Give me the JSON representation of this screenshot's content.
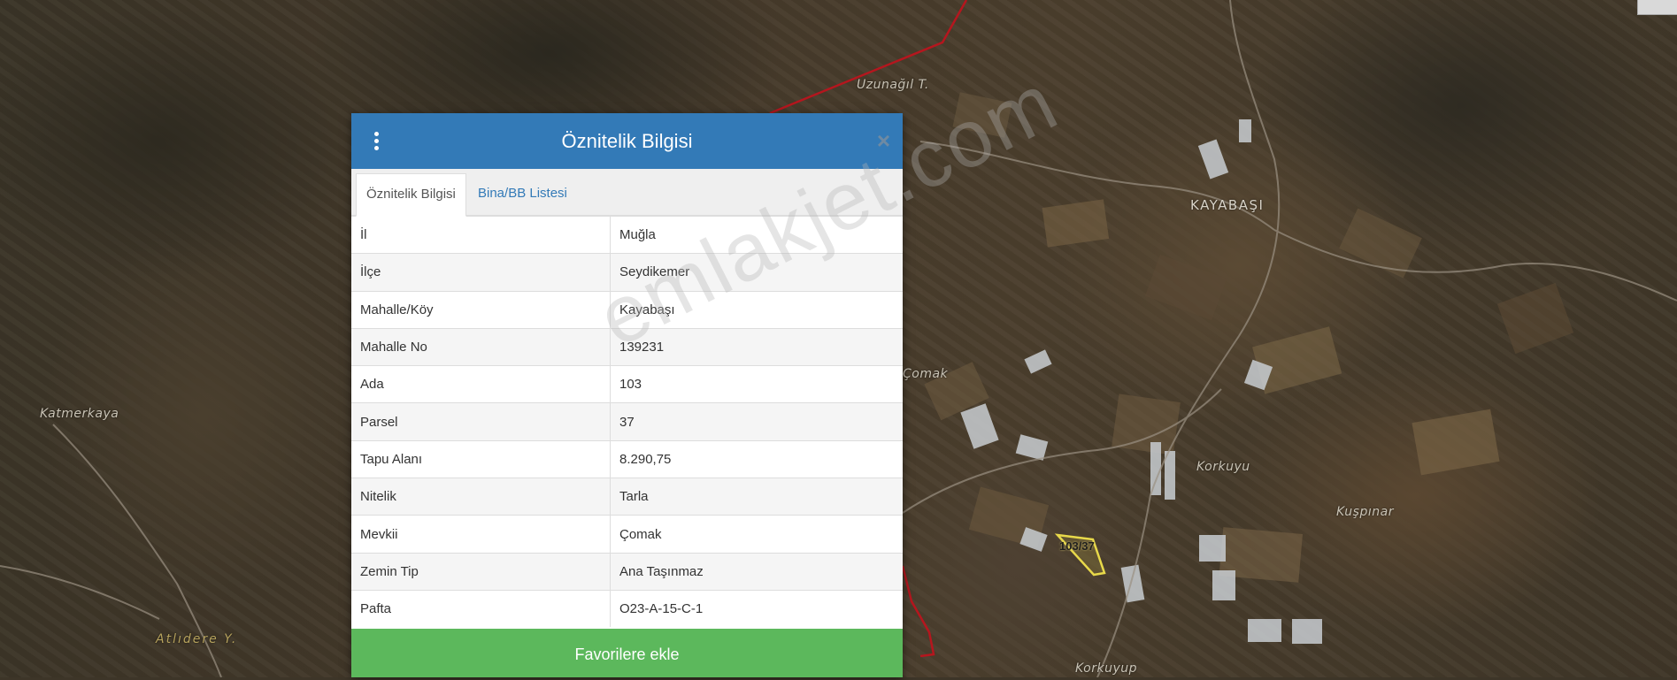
{
  "map": {
    "labels": [
      "Uzunağıl T.",
      "KAYABAŞI",
      "Çomak",
      "Katmerkaya",
      "Korkuyu",
      "Kuşpınar",
      "Atlıdere Y.",
      "Korkuyup"
    ],
    "parcel_label": "103/37",
    "watermark": "emlakjet.com"
  },
  "modal": {
    "title": "Öznitelik Bilgisi",
    "menu_icon": "kebab-menu-icon",
    "close_symbol": "×",
    "tabs": [
      {
        "label": "Öznitelik Bilgisi",
        "active": true
      },
      {
        "label": "Bina/BB Listesi",
        "active": false
      }
    ],
    "rows": [
      {
        "key": "İl",
        "value": "Muğla"
      },
      {
        "key": "İlçe",
        "value": "Seydikemer"
      },
      {
        "key": "Mahalle/Köy",
        "value": "Kayabaşı"
      },
      {
        "key": "Mahalle No",
        "value": "139231"
      },
      {
        "key": "Ada",
        "value": "103"
      },
      {
        "key": "Parsel",
        "value": "37"
      },
      {
        "key": "Tapu Alanı",
        "value": "8.290,75"
      },
      {
        "key": "Nitelik",
        "value": "Tarla"
      },
      {
        "key": "Mevkii",
        "value": "Çomak"
      },
      {
        "key": "Zemin Tip",
        "value": "Ana Taşınmaz"
      },
      {
        "key": "Pafta",
        "value": "O23-A-15-C-1"
      }
    ],
    "favorite_button": "Favorilere ekle"
  },
  "colors": {
    "header": "#337ab7",
    "favorite": "#5cb85c",
    "boundary_line": "#b5161e",
    "parcel_outline": "#e8d94a"
  }
}
